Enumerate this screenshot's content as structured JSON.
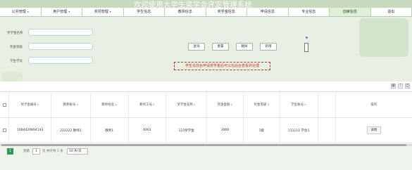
{
  "app": {
    "title": "欢迎使用大学生奖学金评定管理系统"
  },
  "nav": [
    {
      "label": "公共管理",
      "dropdown": true
    },
    {
      "label": "用户管理",
      "dropdown": true
    },
    {
      "label": "奖项管理",
      "dropdown": true
    },
    {
      "label": "学生信息",
      "dropdown": false
    },
    {
      "label": "教师信息",
      "dropdown": false
    },
    {
      "label": "奖学金信息",
      "dropdown": false
    },
    {
      "label": "申请信息",
      "dropdown": false
    },
    {
      "label": "专业信息",
      "dropdown": false
    },
    {
      "label": "创审信息",
      "dropdown": false,
      "active": true
    },
    {
      "label": "退出",
      "dropdown": false
    }
  ],
  "search": {
    "fields": [
      {
        "label": "奖学金名称",
        "value": ""
      },
      {
        "label": "奖金等级",
        "value": ""
      },
      {
        "label": "学生学号",
        "value": ""
      }
    ],
    "buttons": {
      "query": "查询",
      "reset": "重置",
      "delete": "删除",
      "add": "新增"
    }
  },
  "notice": "学生在前台申请奖学金后可以在后台查看并处理",
  "toolbar_icons": [
    "grid-icon",
    "export-icon",
    "print-icon"
  ],
  "table": {
    "headers": [
      "奖学金编号",
      "教师账号",
      "教师姓名",
      "教师工号",
      "奖学金名称",
      "奖金金额",
      "奖金等级",
      "学生账号",
      "",
      "操作"
    ],
    "rows": [
      [
        "1684420894143",
        "222222 教师1",
        "教师1",
        "0001",
        "123奖学金",
        "3000",
        "1级",
        "111111 学生1",
        "",
        "详情"
      ]
    ]
  },
  "pager": {
    "current": "1",
    "goto_label": "到第",
    "page_value": "1",
    "page_unit": "页",
    "total": "共计共 1 条",
    "page_size": "10 条/页"
  },
  "colors": {
    "accent": "#2e9a5a",
    "notice": "#c0392b"
  }
}
